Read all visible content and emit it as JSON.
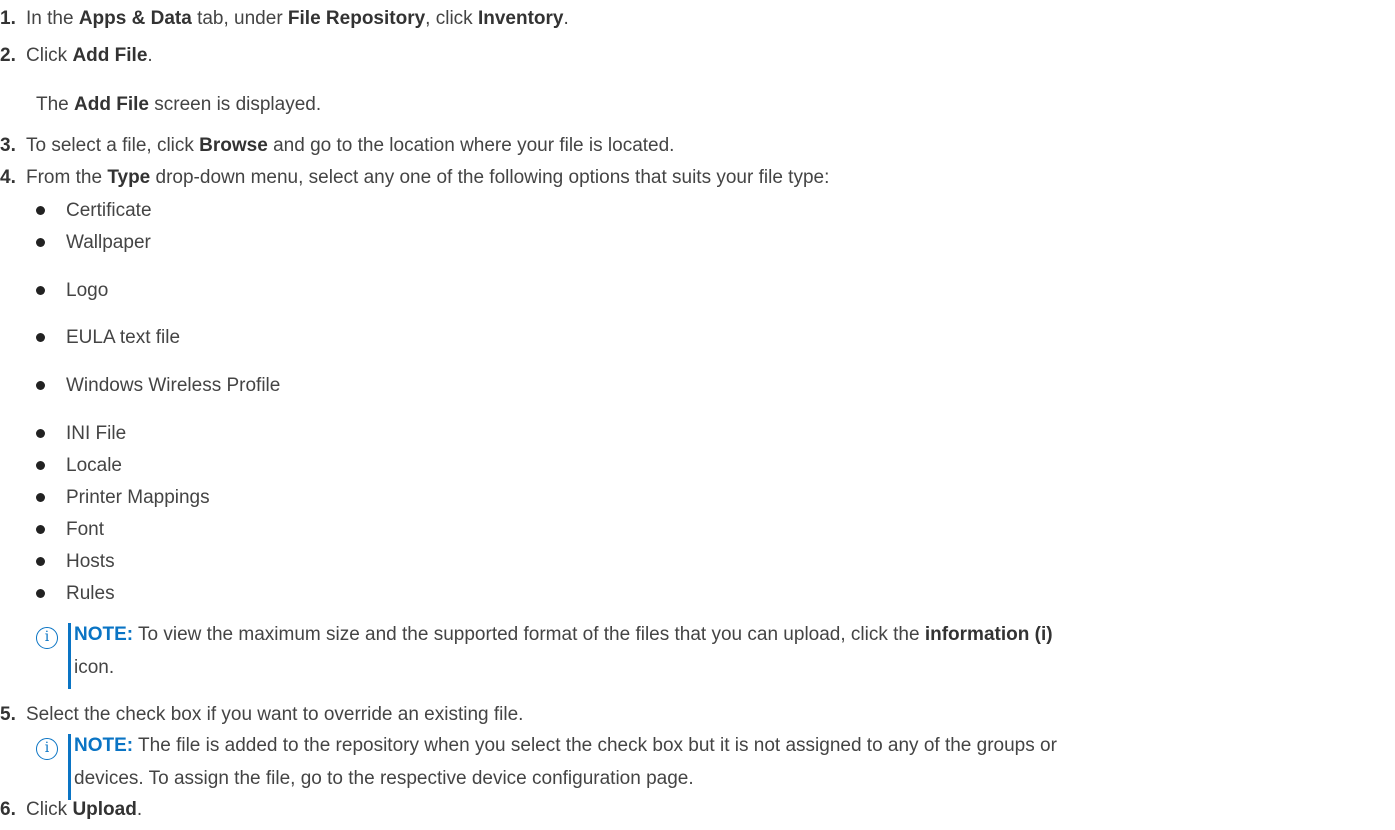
{
  "steps": [
    {
      "num": "1.",
      "pre": "In the ",
      "b1": "Apps & Data",
      "mid1": " tab, under ",
      "b2": "File Repository",
      "mid2": ", click ",
      "b3": "Inventory",
      "post": "."
    },
    {
      "num": "2.",
      "pre": "Click ",
      "b1": "Add File",
      "post": "."
    },
    {
      "num": "3.",
      "pre": "To select a file, click ",
      "b1": "Browse",
      "post": " and go to the location where your file is located."
    },
    {
      "num": "4.",
      "pre": "From the ",
      "b1": "Type",
      "post": " drop-down menu, select any one of the following options that suits your file type:"
    },
    {
      "num": "5.",
      "text": "Select the check box if you want to override an existing file."
    },
    {
      "num": "6.",
      "pre": "Click ",
      "b1": "Upload",
      "post": "."
    }
  ],
  "step2_result": {
    "pre": "The ",
    "b1": "Add File",
    "post": " screen is displayed."
  },
  "file_types": [
    "Certificate",
    "Wallpaper",
    "Logo",
    "EULA text file",
    "Windows Wireless Profile",
    "INI File",
    "Locale",
    "Printer Mappings",
    "Font",
    "Hosts",
    "Rules"
  ],
  "note1": {
    "label": "NOTE:",
    "line1_pre": " To view the maximum size and the supported format of the files that you can upload, click the ",
    "line1_bold": "information (i)",
    "line2": "icon."
  },
  "note2": {
    "label": "NOTE:",
    "line1": " The file is added to the repository when you select the check box but it is not assigned to any of the groups or",
    "line2": "devices. To assign the file, go to the respective device configuration page."
  },
  "icons": {
    "note": "info-icon",
    "bullet": "bullet-dot-icon"
  },
  "colors": {
    "accent": "#0a74c4",
    "text": "#444444"
  }
}
